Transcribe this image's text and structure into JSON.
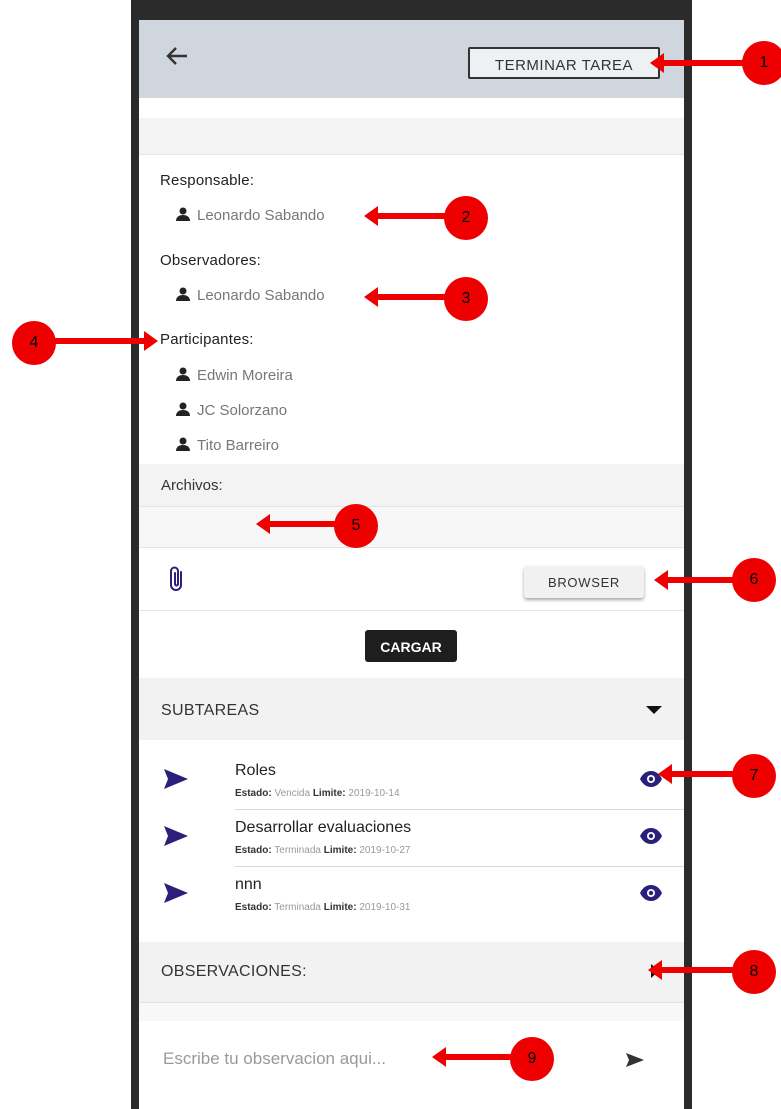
{
  "header": {
    "back_icon": "arrow-left-icon",
    "terminar_label": "TERMINAR TAREA"
  },
  "people": {
    "responsable_label": "Responsable:",
    "responsable": [
      "Leonardo Sabando"
    ],
    "observadores_label": "Observadores:",
    "observadores": [
      "Leonardo Sabando"
    ],
    "participantes_label": "Participantes:",
    "participantes": [
      "Edwin Moreira",
      "JC Solorzano",
      "Tito Barreiro"
    ],
    "person_icon": "person-icon"
  },
  "files": {
    "label": "Archivos:",
    "clip_icon": "paperclip-icon",
    "browser_label": "BROWSER",
    "cargar_label": "CARGAR"
  },
  "subtareas": {
    "header": "SUBTAREAS",
    "estado_label": "Estado:",
    "limite_label": "Limite:",
    "items": [
      {
        "title": "Roles",
        "estado": "Vencida",
        "limite": "2019-10-14"
      },
      {
        "title": "Desarrollar evaluaciones",
        "estado": "Terminada",
        "limite": "2019-10-27"
      },
      {
        "title": "nnn",
        "estado": "Terminada",
        "limite": "2019-10-31"
      }
    ]
  },
  "observaciones": {
    "header": "OBSERVACIONES:",
    "placeholder": "Escribe tu observacion aqui..."
  },
  "markers": [
    "1",
    "2",
    "3",
    "4",
    "5",
    "6",
    "7",
    "8",
    "9"
  ],
  "colors": {
    "accent": "#2a1f7a",
    "annotation": "#ee0000",
    "appbar": "#d0d6dd"
  }
}
